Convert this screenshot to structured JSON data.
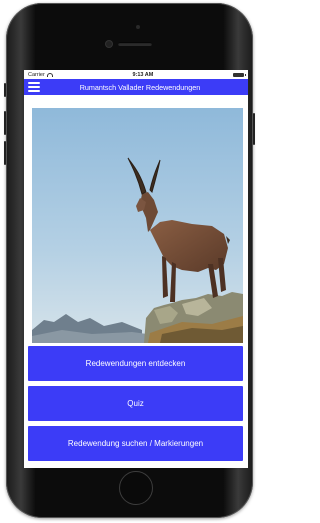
{
  "status_bar": {
    "carrier": "Carrier",
    "time": "9:13 AM",
    "icons": [
      "wifi-icon",
      "battery-icon"
    ]
  },
  "nav_bar": {
    "menu_icon": "hamburger-menu-icon",
    "title": "Rumantsch Vallader Redewendungen"
  },
  "hero_image": {
    "subject": "ibex-photo"
  },
  "buttons": [
    {
      "label": "Redewendungen entdecken"
    },
    {
      "label": "Quiz"
    },
    {
      "label": "Redewendung suchen / Markierungen"
    }
  ],
  "colors": {
    "accent": "#3c3cf7",
    "sky": "#9ec3de",
    "ibex": "#6e4a35"
  }
}
